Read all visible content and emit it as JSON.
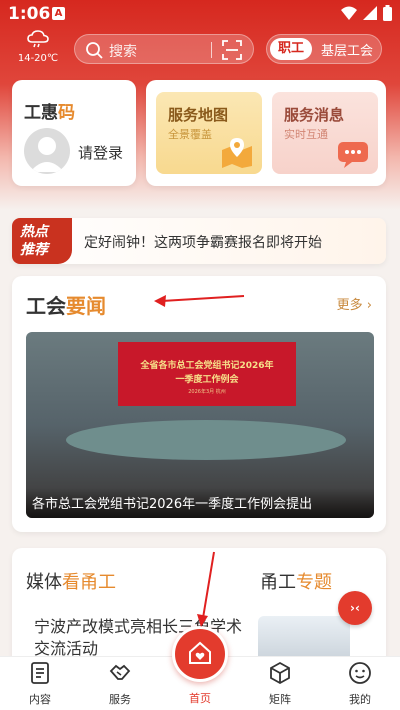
{
  "status_bar": {
    "time": "1:06",
    "notif_letter": "A"
  },
  "weather": {
    "temp": "14-20℃",
    "icon": "cloud-rain-icon"
  },
  "search": {
    "placeholder": "搜索",
    "scan_icon": "scan-icon"
  },
  "role_toggle": {
    "active": "职工",
    "inactive": "基层工会"
  },
  "login_card": {
    "title_main": "工惠",
    "title_accent": "码",
    "login_label": "请登录"
  },
  "services": [
    {
      "title": "服务地图",
      "subtitle": "全景覆盖",
      "icon": "map-pin-icon"
    },
    {
      "title": "服务消息",
      "subtitle": "实时互通",
      "icon": "chat-bubble-icon"
    }
  ],
  "hot": {
    "badge_line1": "热点",
    "badge_line2": "推荐",
    "text": "定好闹钟！这两项争霸赛报名即将开始"
  },
  "news": {
    "title_main": "工会",
    "title_accent": "要闻",
    "more": "更多 ›",
    "photo_stage_line1": "全省各市总工会党组书记2026年",
    "photo_stage_line2": "一季度工作例会",
    "photo_stage_line3": "2026年3月 杭州",
    "caption": "各市总工会党组书记2026年一季度工作例会提出"
  },
  "lower": {
    "tab1_main": "媒体",
    "tab1_accent": "看甬工",
    "tab2_main": "甬工",
    "tab2_accent": "专题",
    "article": "宁波产改模式亮相长三角学术交流活动",
    "float_label": "›‹"
  },
  "bottom_nav": {
    "items": [
      {
        "label": "内容",
        "icon": "document-icon"
      },
      {
        "label": "服务",
        "icon": "handshake-icon"
      },
      {
        "label": "首页",
        "icon": "home-heart-icon"
      },
      {
        "label": "矩阵",
        "icon": "cube-icon"
      },
      {
        "label": "我的",
        "icon": "user-icon"
      }
    ]
  },
  "colors": {
    "brand_red": "#d6281f",
    "accent_orange": "#e68a2e",
    "annotation_arrow": "#e02020"
  }
}
